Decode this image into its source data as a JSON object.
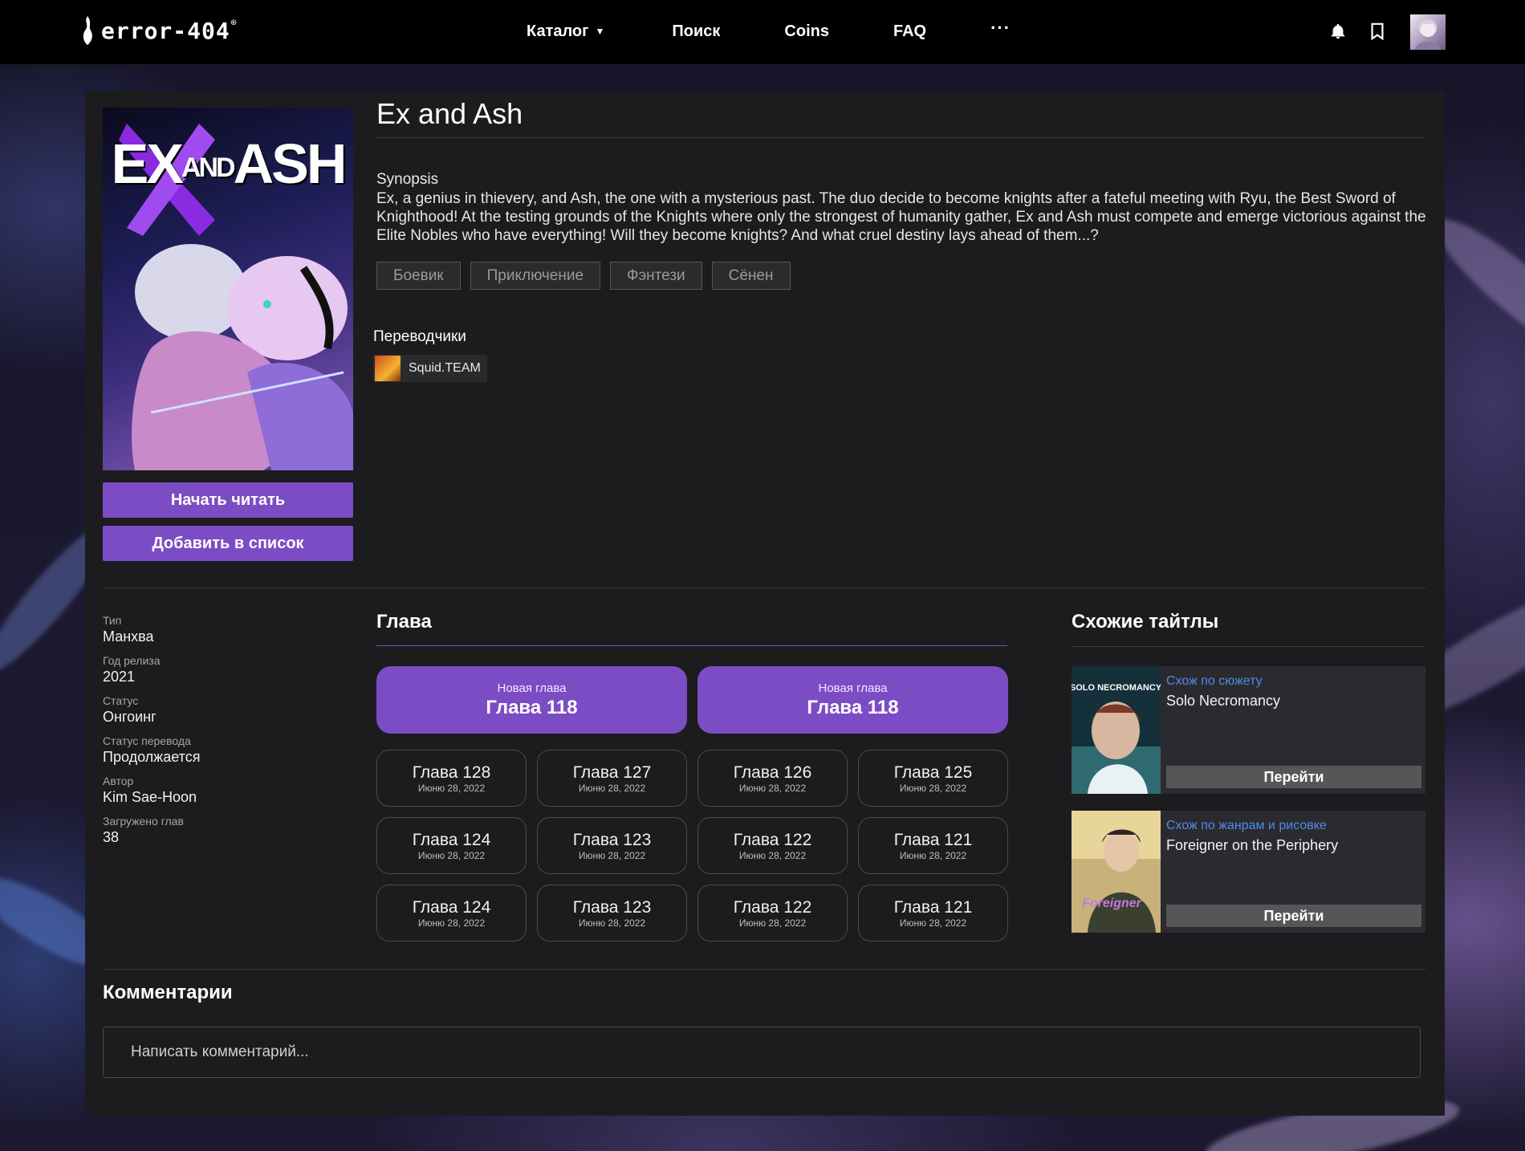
{
  "header": {
    "logo_text": "error-404",
    "logo_mark": "®",
    "nav": {
      "catalog": "Каталог",
      "search": "Поиск",
      "coins": "Coins",
      "faq": "FAQ",
      "more": "···"
    }
  },
  "title": {
    "name": "Ex and Ash",
    "cover_title_part1": "EX",
    "cover_title_and": "AND",
    "cover_title_part2": "ASH",
    "start_reading": "Начать читать",
    "add_to_list": "Добавить в список",
    "synopsis_heading": "Synopsis",
    "synopsis": "Ex, a genius in thievery, and Ash, the one with a mysterious past. The duo decide to become knights after a fateful meeting with Ryu, the Best Sword of Knighthood! At the testing grounds of the Knights where only the strongest of humanity gather, Ex and Ash must compete and emerge victorious against the Elite Nobles who have everything! Will they become knights? And what cruel destiny lays ahead of them...?",
    "tags": [
      "Боевик",
      "Приключение",
      "Фэнтези",
      "Сёнен"
    ],
    "translators_heading": "Переводчики",
    "translator": "Squid.TEAM"
  },
  "info": [
    {
      "label": "Тип",
      "value": "Манхва"
    },
    {
      "label": "Год релиза",
      "value": "2021"
    },
    {
      "label": "Статус",
      "value": "Онгоинг"
    },
    {
      "label": "Статус перевода",
      "value": "Продолжается"
    },
    {
      "label": "Автор",
      "value": "Kim Sae-Hoon"
    },
    {
      "label": "Загружено глав",
      "value": "38"
    }
  ],
  "chapters": {
    "heading": "Глава",
    "new": [
      {
        "label": "Новая глава",
        "chapter": "Глава 118"
      },
      {
        "label": "Новая глава",
        "chapter": "Глава 118"
      }
    ],
    "list": [
      {
        "name": "Глава 128",
        "date": "Июню 28, 2022"
      },
      {
        "name": "Глава 127",
        "date": "Июню 28, 2022"
      },
      {
        "name": "Глава 126",
        "date": "Июню 28, 2022"
      },
      {
        "name": "Глава 125",
        "date": "Июню 28, 2022"
      },
      {
        "name": "Глава 124",
        "date": "Июню 28, 2022"
      },
      {
        "name": "Глава 123",
        "date": "Июню 28, 2022"
      },
      {
        "name": "Глава 122",
        "date": "Июню 28, 2022"
      },
      {
        "name": "Глава 121",
        "date": "Июню 28, 2022"
      },
      {
        "name": "Глава 124",
        "date": "Июню 28, 2022"
      },
      {
        "name": "Глава 123",
        "date": "Июню 28, 2022"
      },
      {
        "name": "Глава 122",
        "date": "Июню 28, 2022"
      },
      {
        "name": "Глава 121",
        "date": "Июню 28, 2022"
      }
    ]
  },
  "similar": {
    "heading": "Схожие тайтлы",
    "items": [
      {
        "kind": "Схож по сюжету",
        "name": "Solo Necromancy",
        "button": "Перейти",
        "thumb_text": "SOLO NECROMANCY"
      },
      {
        "kind": "Схож по жанрам и рисовке",
        "name": "Foreigner on the Periphery",
        "button": "Перейти",
        "thumb_text": "Foreigner"
      }
    ]
  },
  "comments": {
    "heading": "Комментарии",
    "placeholder": "Написать комментарий..."
  },
  "colors": {
    "accent": "#7c4cc4",
    "panel": "#1c1c1f",
    "link": "#4c8de8"
  }
}
